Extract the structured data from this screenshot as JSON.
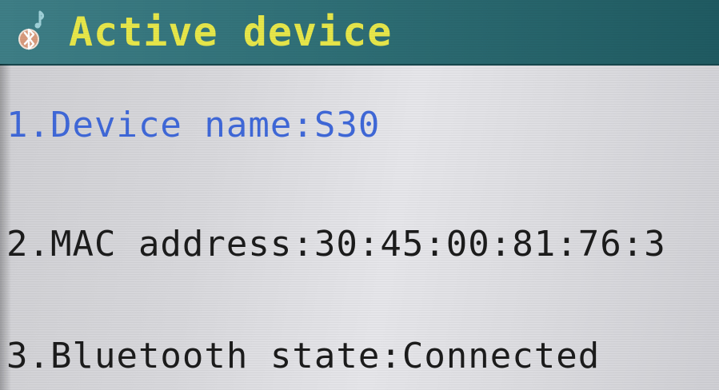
{
  "title_bar": {
    "icon": "bluetooth-icon",
    "title": "Active device",
    "colors": {
      "background": "#2f6f76",
      "title_text": "#e6e64a"
    }
  },
  "menu": {
    "items": [
      {
        "label": "1.Device name:S30",
        "selected": true,
        "color": "#3f68d8"
      },
      {
        "label": "2.MAC address:30:45:00:81:76:3",
        "selected": false,
        "color": "#1c1c1c"
      },
      {
        "label": "3.Bluetooth state:Connected",
        "selected": false,
        "color": "#1c1c1c"
      }
    ]
  }
}
